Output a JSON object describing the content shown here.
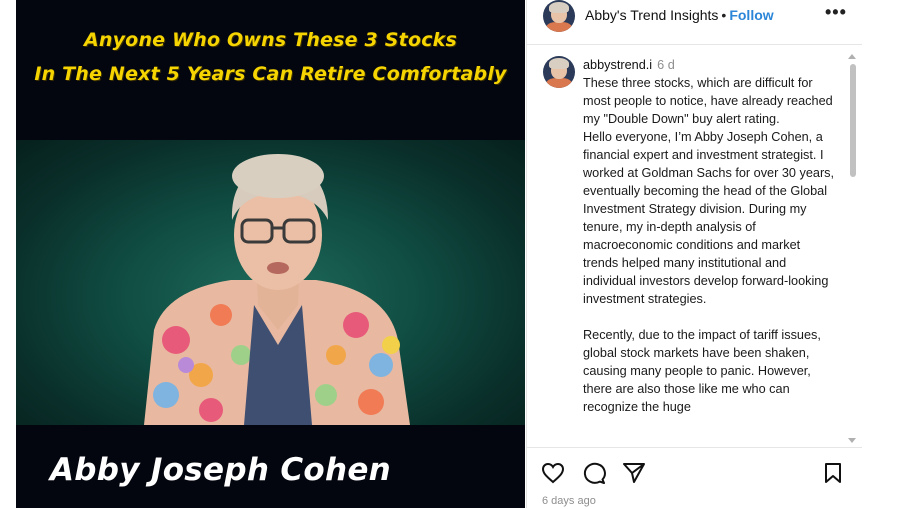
{
  "media": {
    "caption_line1": "Anyone Who Owns These 3 Stocks",
    "caption_line2": "In The Next 5 Years Can Retire Comfortably",
    "name_banner": "Abby Joseph Cohen"
  },
  "header": {
    "account_name": "Abby's Trend Insights",
    "separator": "•",
    "follow_label": "Follow",
    "more_icon": "more-horizontal-icon"
  },
  "caption": {
    "username": "abbystrend.i",
    "age": "6 d",
    "paragraphs": [
      "These three stocks, which are difficult for most people to notice, have already reached my \"Double Down\" buy alert rating.",
      "Hello everyone, I’m Abby Joseph Cohen, a financial expert and investment strategist. I worked at Goldman Sachs for over 30 years, eventually becoming the head of the Global Investment Strategy division. During my tenure, my in-depth analysis of macroeconomic conditions and market trends helped many institutional and individual investors develop forward-looking investment strategies.",
      "Recently, due to the impact of tariff issues, global stock markets have been shaken, causing many people to panic. However, there are also those like me who can recognize the huge"
    ]
  },
  "actions": {
    "icons": [
      "heart-icon",
      "comment-icon",
      "share-icon",
      "bookmark-icon"
    ],
    "timestamp": "6 days ago"
  },
  "colors": {
    "caption_yellow": "#f5d400",
    "follow_blue": "#2c86d8",
    "media_background": "#04060f",
    "studio_teal": "#1f6b5c"
  }
}
